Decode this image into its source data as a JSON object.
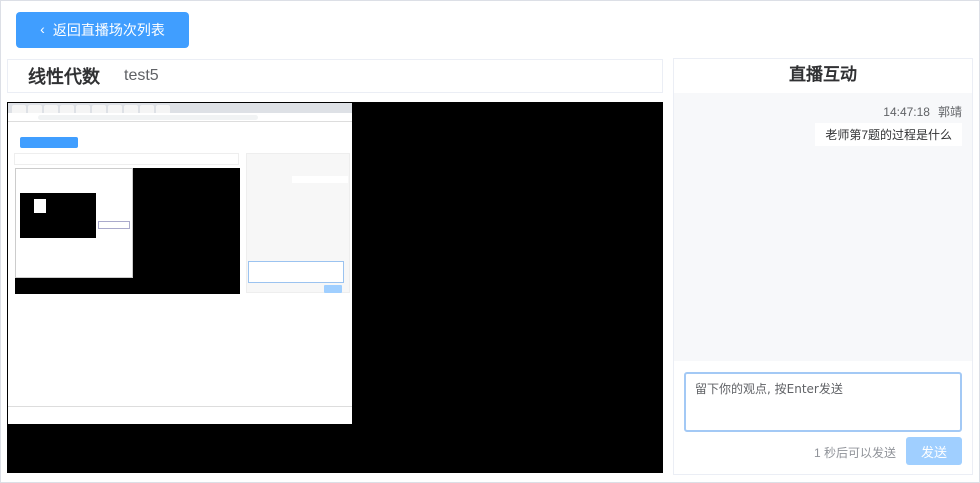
{
  "header": {
    "back_button_label": "返回直播场次列表"
  },
  "title_bar": {
    "course_name": "线性代数",
    "session_name": "test5"
  },
  "chat": {
    "title": "直播互动",
    "messages": [
      {
        "time": "14:47:18",
        "author": "郭靖",
        "text": "老师第7题的过程是什么"
      }
    ],
    "input_placeholder": "留下你的观点, 按Enter发送",
    "cooldown_text": "1 秒后可以发送",
    "send_label": "发送"
  },
  "colors": {
    "primary": "#409eff",
    "primary_disabled": "#a0cfff",
    "chat_bg": "#f7f8fa"
  }
}
